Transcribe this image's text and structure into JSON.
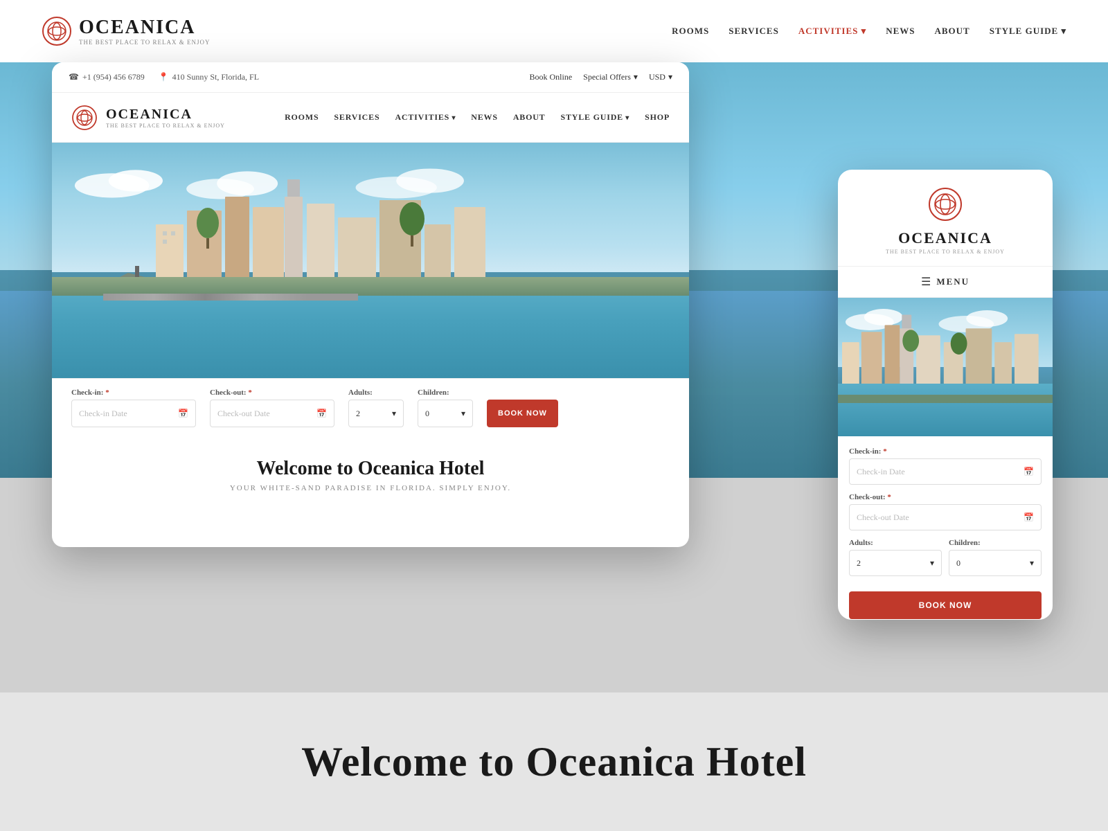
{
  "background": {
    "brand": {
      "name": "OCEANICA",
      "tagline": "THE BEST PLACE TO RELAX & ENJOY"
    },
    "nav": {
      "items": [
        "ROOMS",
        "SERVICES",
        "ACTIVITIES",
        "NEWS",
        "ABOUT",
        "STYLE GUIDE"
      ]
    },
    "welcome": {
      "title": "Welcome to Oceanica Hotel"
    }
  },
  "desktop_card": {
    "topbar": {
      "phone": "+1 (954) 456 6789",
      "address": "410 Sunny St, Florida, FL",
      "book_online": "Book Online",
      "special_offers": "Special Offers",
      "currency": "USD"
    },
    "nav": {
      "brand": {
        "name": "OCEANICA",
        "tagline": "THE BEST PLACE TO RELAX & ENJOY"
      },
      "items": [
        "ROOMS",
        "SERVICES",
        "ACTIVITIES",
        "NEWS",
        "ABOUT",
        "STYLE GUIDE",
        "SHOP"
      ]
    },
    "booking": {
      "checkin_label": "Check-in:",
      "checkin_placeholder": "Check-in Date",
      "checkout_label": "Check-out:",
      "checkout_placeholder": "Check-out Date",
      "adults_label": "Adults:",
      "adults_value": "2",
      "children_label": "Children:",
      "children_value": "0",
      "required_marker": "*"
    },
    "welcome": {
      "title": "Welcome to Oceanica Hotel",
      "subtitle": "YOUR WHITE-SAND PARADISE IN FLORIDA. SIMPLY ENJOY."
    }
  },
  "mobile_card": {
    "brand": {
      "name": "OCEANICA",
      "tagline": "THE BEST PLACE TO RELAX & ENJOY"
    },
    "menu_label": "MENU",
    "booking": {
      "checkin_label": "Check-in:",
      "checkin_placeholder": "Check-in Date",
      "checkout_label": "Check-out:",
      "checkout_placeholder": "Check-out Date",
      "adults_label": "Adults:",
      "adults_value": "2",
      "children_label": "Children:",
      "children_value": "0",
      "required_marker": "*"
    }
  },
  "colors": {
    "brand_red": "#c0392b",
    "dark": "#1a1a1a",
    "medium": "#555555",
    "light": "#888888",
    "border": "#dddddd",
    "bg": "#f5f5f5"
  },
  "icons": {
    "phone": "☎",
    "location": "📍",
    "calendar": "📅",
    "chevron_down": "▾",
    "hamburger": "☰"
  }
}
